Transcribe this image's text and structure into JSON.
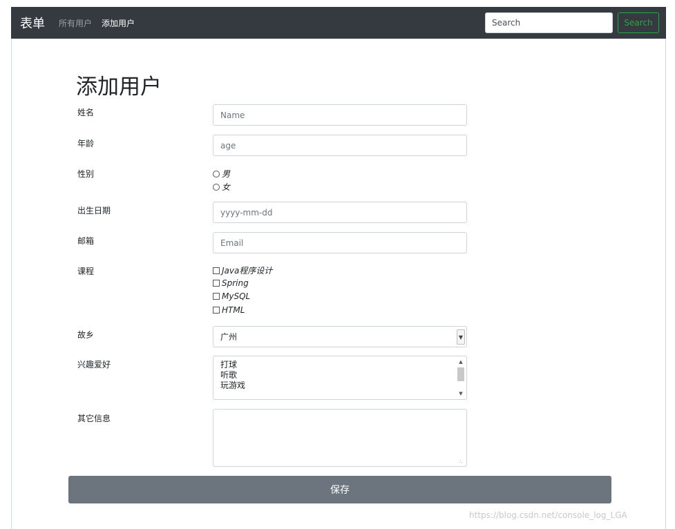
{
  "navbar": {
    "brand": "表单",
    "links": [
      {
        "label": "所有用户",
        "active": false
      },
      {
        "label": "添加用户",
        "active": true
      }
    ],
    "search_placeholder": "Search",
    "search_button": "Search"
  },
  "form": {
    "title": "添加用户",
    "name": {
      "label": "姓名",
      "placeholder": "Name"
    },
    "age": {
      "label": "年龄",
      "placeholder": "age"
    },
    "gender": {
      "label": "性别",
      "options": [
        "男",
        "女"
      ]
    },
    "birthday": {
      "label": "出生日期",
      "placeholder": "yyyy-mm-dd"
    },
    "email": {
      "label": "邮箱",
      "placeholder": "Email"
    },
    "courses": {
      "label": "课程",
      "options": [
        "Java程序设计",
        "Spring",
        "MySQL",
        "HTML"
      ]
    },
    "hometown": {
      "label": "故乡",
      "selected": "广州"
    },
    "hobbies": {
      "label": "兴趣爱好",
      "options": [
        "打球",
        "听歌",
        "玩游戏"
      ]
    },
    "other": {
      "label": "其它信息"
    },
    "save_label": "保存"
  },
  "watermark": "https://blog.csdn.net/console_log_LGA"
}
